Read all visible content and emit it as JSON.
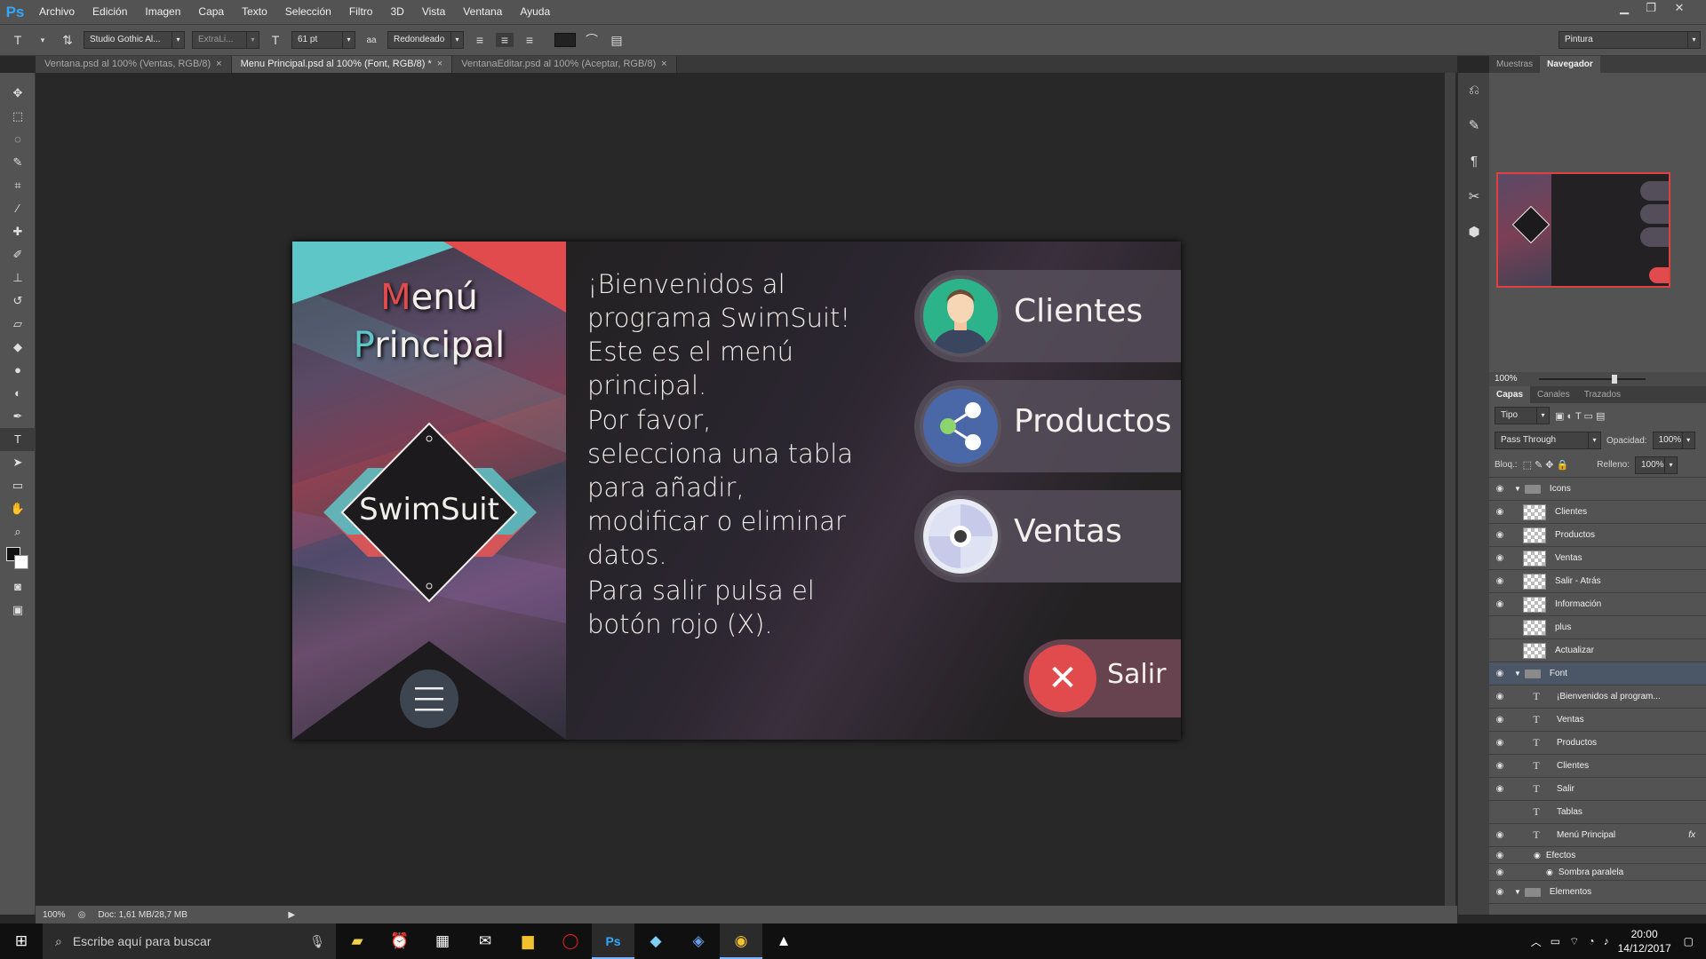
{
  "app": {
    "logo": "Ps"
  },
  "menubar": {
    "items": [
      "Archivo",
      "Edición",
      "Imagen",
      "Capa",
      "Texto",
      "Selección",
      "Filtro",
      "3D",
      "Vista",
      "Ventana",
      "Ayuda"
    ]
  },
  "options": {
    "tool_icon": "T",
    "font_family": "Studio Gothic Al...",
    "font_style": "ExtraLi...",
    "font_size": "61 pt",
    "aa_icon": "aa",
    "antialias": "Redondeado",
    "workspace": "Pintura"
  },
  "tabs": [
    {
      "label": "Ventana.psd al 100% (Ventas, RGB/8)"
    },
    {
      "label": "Menu Principal.psd al 100% (Font, RGB/8) *"
    },
    {
      "label": "VentanaEditar.psd al 100% (Aceptar, RGB/8)"
    }
  ],
  "tab_close": "×",
  "status": {
    "zoom": "100%",
    "doc": "Doc: 1,61 MB/28,7 MB"
  },
  "document": {
    "title_line1": "Menú",
    "title_line2": "Principal",
    "logo_text": "SwimSuit",
    "para1": "¡Bienvenidos al programa SwimSuit! Este es el menú principal.",
    "para2": "Por favor, selecciona una tabla para añadir, modificar o eliminar datos.",
    "para3": "Para salir pulsa el botón rojo (X).",
    "buttons": {
      "clientes": "Clientes",
      "productos": "Productos",
      "ventas": "Ventas",
      "salir": "Salir"
    },
    "colors": {
      "teal": "#5fc6c8",
      "red": "#e14b4e",
      "blue": "#4a67a8",
      "green": "#2db38a",
      "dark": "#232122"
    }
  },
  "right_panel": {
    "top_tabs": [
      "Muestras",
      "Navegador"
    ],
    "nav_zoom": "100%",
    "layer_tabs": [
      "Capas",
      "Canales",
      "Trazados"
    ],
    "kind": "Tipo",
    "blend": "Pass Through",
    "opacity_label": "Opacidad:",
    "opacity": "100%",
    "lock_label": "Bloq.:",
    "fill_label": "Relleno:",
    "fill": "100%",
    "layers": [
      {
        "name": "Icons",
        "type": "folder",
        "visible": true
      },
      {
        "name": "Clientes",
        "type": "image",
        "visible": true
      },
      {
        "name": "Productos",
        "type": "image",
        "visible": true
      },
      {
        "name": "Ventas",
        "type": "image",
        "visible": true
      },
      {
        "name": "Salir - Atrás",
        "type": "image",
        "visible": true
      },
      {
        "name": "Información",
        "type": "image",
        "visible": true
      },
      {
        "name": "plus",
        "type": "image",
        "visible": false
      },
      {
        "name": "Actualizar",
        "type": "image",
        "visible": false
      },
      {
        "name": "Font",
        "type": "folder",
        "visible": true,
        "selected": true
      },
      {
        "name": "¡Bienvenidos al program...",
        "type": "text",
        "visible": true
      },
      {
        "name": "Ventas",
        "type": "text",
        "visible": true
      },
      {
        "name": "Productos",
        "type": "text",
        "visible": true
      },
      {
        "name": "Clientes",
        "type": "text",
        "visible": true
      },
      {
        "name": "Salir",
        "type": "text",
        "visible": true
      },
      {
        "name": "Tablas",
        "type": "text",
        "visible": false
      },
      {
        "name": "Menú Principal",
        "type": "text",
        "visible": true,
        "fx": "fx"
      },
      {
        "name": "Efectos",
        "type": "effect",
        "visible": true
      },
      {
        "name": "Sombra paralela",
        "type": "effect",
        "visible": true
      },
      {
        "name": "Elementos",
        "type": "folder",
        "visible": true
      }
    ]
  },
  "taskbar": {
    "search_placeholder": "Escribe aquí para buscar",
    "time": "20:00",
    "date": "14/12/2017"
  }
}
